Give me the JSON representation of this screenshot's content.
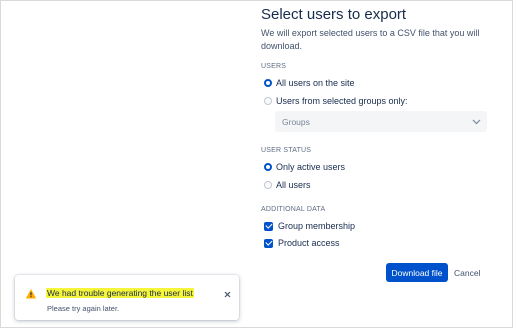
{
  "dialog": {
    "title": "Select users to export",
    "description": "We will export selected users to a CSV file that you will download.",
    "users_section": {
      "label": "USERS",
      "options": [
        {
          "label": "All users on the site",
          "checked": true
        },
        {
          "label": "Users from selected groups only:",
          "checked": false
        }
      ],
      "groups_select": {
        "placeholder": "Groups",
        "icon": "chevron-down-icon"
      }
    },
    "user_status_section": {
      "label": "USER STATUS",
      "options": [
        {
          "label": "Only active users",
          "checked": true
        },
        {
          "label": "All users",
          "checked": false
        }
      ]
    },
    "additional_data_section": {
      "label": "ADDITIONAL DATA",
      "options": [
        {
          "label": "Group membership",
          "checked": true
        },
        {
          "label": "Product access",
          "checked": true
        }
      ]
    },
    "actions": {
      "primary_label": "Download file",
      "cancel_label": "Cancel"
    }
  },
  "flag": {
    "icon": "warning-icon",
    "title": "We had trouble generating the user list",
    "body": "Please try again later.",
    "close_icon": "close-icon",
    "highlight_color": "#f5f53a"
  },
  "colors": {
    "primary": "#0052cc",
    "warning": "#ffab00",
    "text": "#172b4d",
    "subtle_text": "#42526e"
  }
}
